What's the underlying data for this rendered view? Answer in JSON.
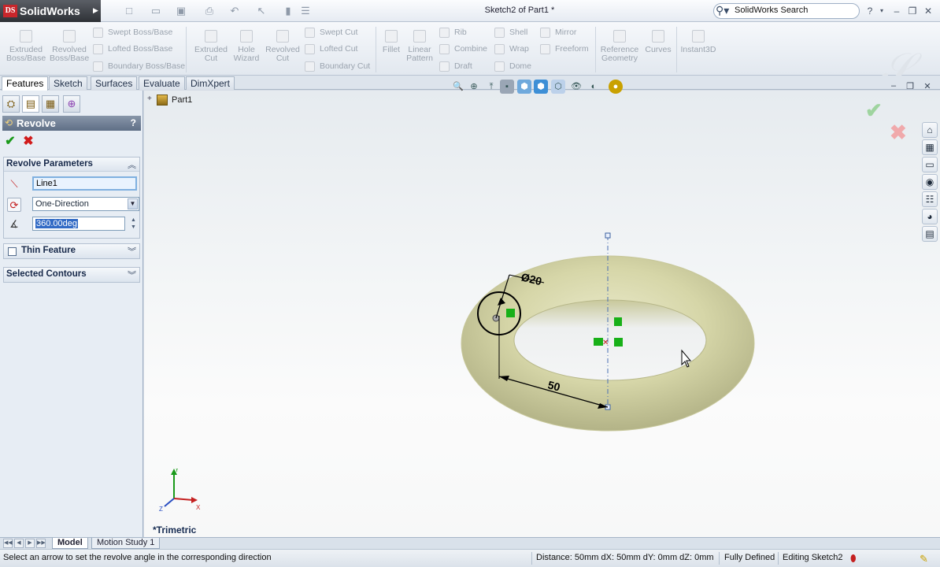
{
  "app": {
    "name": "SolidWorks",
    "logo_mark": "DS"
  },
  "titlebar": {
    "document_title": "Sketch2 of Part1 *",
    "search_value": "SolidWorks Search"
  },
  "command_manager": {
    "big_tools": [
      {
        "label1": "Extruded",
        "label2": "Boss/Base"
      },
      {
        "label1": "Revolved",
        "label2": "Boss/Base"
      },
      {
        "label1": "Extruded",
        "label2": "Cut"
      },
      {
        "label1": "Hole",
        "label2": "Wizard"
      },
      {
        "label1": "Revolved",
        "label2": "Cut"
      },
      {
        "label1": "Fillet",
        "label2": ""
      },
      {
        "label1": "Linear",
        "label2": "Pattern"
      },
      {
        "label1": "Reference",
        "label2": "Geometry"
      },
      {
        "label1": "Curves",
        "label2": ""
      },
      {
        "label1": "Instant3D",
        "label2": ""
      }
    ],
    "small_tools": {
      "swept_boss": "Swept Boss/Base",
      "lofted_boss": "Lofted Boss/Base",
      "boundary_boss": "Boundary Boss/Base",
      "swept_cut": "Swept Cut",
      "lofted_cut": "Lofted Cut",
      "boundary_cut": "Boundary Cut",
      "rib": "Rib",
      "combine": "Combine",
      "draft": "Draft",
      "shell": "Shell",
      "wrap": "Wrap",
      "dome": "Dome",
      "mirror": "Mirror",
      "freeform": "Freeform"
    }
  },
  "tabs": [
    "Features",
    "Sketch",
    "Surfaces",
    "Evaluate",
    "DimXpert"
  ],
  "property_manager": {
    "title": "Revolve",
    "help": "?",
    "revolve_parameters": {
      "title": "Revolve Parameters",
      "axis_value": "Line1",
      "direction_value": "One-Direction",
      "angle_value": "360.00deg"
    },
    "thin_feature": {
      "title": "Thin Feature"
    },
    "selected_contours": {
      "title": "Selected Contours"
    }
  },
  "graphics": {
    "tree_root": "Part1",
    "view_name": "*Trimetric",
    "dim_diameter": "Ø20",
    "dim_radius": "50"
  },
  "bottom_tabs": [
    "Model",
    "Motion Study 1"
  ],
  "status": {
    "hint": "Select an arrow to set the revolve angle in the corresponding direction",
    "distance": "Distance: 50mm  dX: 50mm  dY: 0mm  dZ: 0mm",
    "defined": "Fully Defined",
    "editing": "Editing Sketch2"
  },
  "colors": {
    "torus_face": "#dcdcb2",
    "torus_shadow": "#a9a97e",
    "sketch_black": "#000000",
    "relation_green": "#18b018",
    "accept_green": "#1a9a1a",
    "cancel_red": "#d11b1b"
  }
}
